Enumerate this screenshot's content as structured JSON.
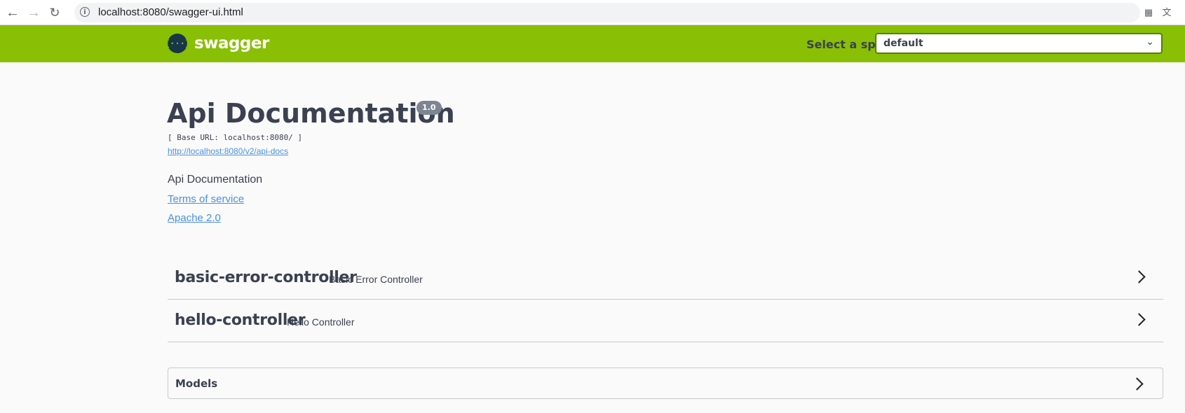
{
  "browser": {
    "url": "localhost:8080/swagger-ui.html"
  },
  "topbar": {
    "logo_mark": "{···}",
    "logo_text": "swagger",
    "spec_label": "Select a spec",
    "spec_value": "default"
  },
  "info": {
    "title": "Api Documentation",
    "version": "1.0",
    "base_url": "[ Base URL: localhost:8080/ ]",
    "api_docs_link": "http://localhost:8080/v2/api-docs",
    "description": "Api Documentation",
    "terms_of_service": "Terms of service",
    "license": "Apache 2.0"
  },
  "controllers": [
    {
      "name": "basic-error-controller",
      "description": "Basic Error Controller"
    },
    {
      "name": "hello-controller",
      "description": "Hello Controller"
    }
  ],
  "models": {
    "label": "Models"
  },
  "colors": {
    "topbar": "#89bf04",
    "link": "#4990e2",
    "text": "#3b4151"
  }
}
